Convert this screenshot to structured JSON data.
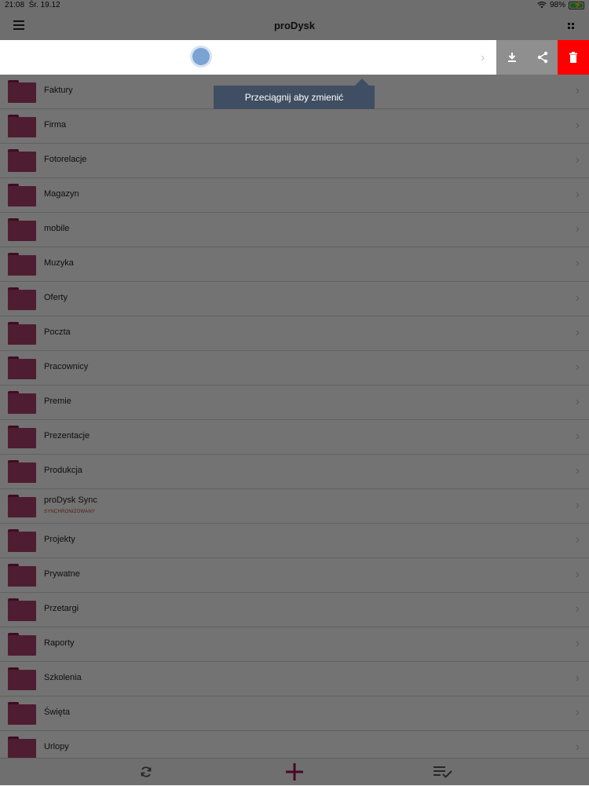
{
  "status_bar": {
    "time": "21:08",
    "date": "Śr. 19.12",
    "battery_percent": "98%",
    "battery_level": 0.98
  },
  "nav": {
    "title": "proDysk"
  },
  "tooltip": {
    "text": "Przeciągnij aby zmienić"
  },
  "folders": [
    {
      "name": "Faktury"
    },
    {
      "name": "Firma"
    },
    {
      "name": "Fotorelacje"
    },
    {
      "name": "Magazyn"
    },
    {
      "name": "mobile"
    },
    {
      "name": "Muzyka"
    },
    {
      "name": "Oferty"
    },
    {
      "name": "Poczta"
    },
    {
      "name": "Pracownicy"
    },
    {
      "name": "Premie"
    },
    {
      "name": "Prezentacje"
    },
    {
      "name": "Produkcja"
    },
    {
      "name": "proDysk Sync",
      "sub": "SYNCHRONIZOWANY"
    },
    {
      "name": "Projekty"
    },
    {
      "name": "Prywatne"
    },
    {
      "name": "Przetargi"
    },
    {
      "name": "Raporty"
    },
    {
      "name": "Szkolenia"
    },
    {
      "name": "Święta"
    },
    {
      "name": "Urlopy"
    }
  ],
  "icons": {
    "menu": "hamburger-icon",
    "view": "grid-icon",
    "download": "download-icon",
    "share": "share-icon",
    "delete": "trash-icon",
    "sync": "sync-icon",
    "add": "plus-icon",
    "queue": "queue-check-icon"
  },
  "colors": {
    "folder": "#b0406d",
    "delete": "#fe0000",
    "tooltip": "#3f4e62",
    "accent": "#a0144a"
  }
}
